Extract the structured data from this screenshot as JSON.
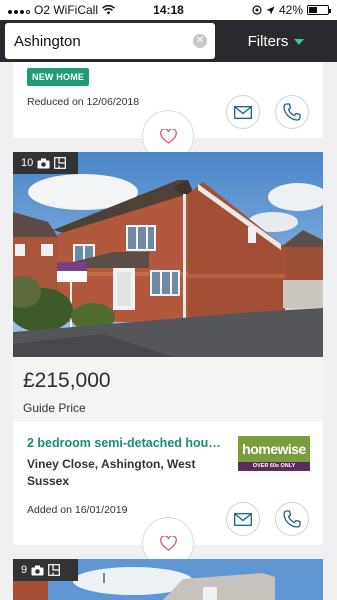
{
  "status_bar": {
    "carrier": "O2 WiFiCall",
    "time": "14:18",
    "battery": "42%",
    "battery_level": 0.42
  },
  "search": {
    "value": "Ashington",
    "filters_label": "Filters"
  },
  "listing_prev": {
    "badge": "NEW HOME",
    "reduced_text": "Reduced on 12/06/2018"
  },
  "listing": {
    "photo_count": "10",
    "price": "£215,000",
    "price_qualifier": "Guide Price",
    "title": "2 bedroom semi-detached hou…",
    "address": "Viney Close, Ashington, West Sussex",
    "added_text": "Added on 16/01/2019",
    "agent_logo": {
      "main": "homewise",
      "tagline": "OVER 60s ONLY"
    }
  },
  "listing_next": {
    "photo_count": "9"
  },
  "colors": {
    "header_bg": "#2a2a2e",
    "accent_green": "#1f9b78",
    "filter_caret": "#3fc0a8",
    "icon_blue": "#1d5f8a",
    "heart_pink": "#d65a7a"
  }
}
